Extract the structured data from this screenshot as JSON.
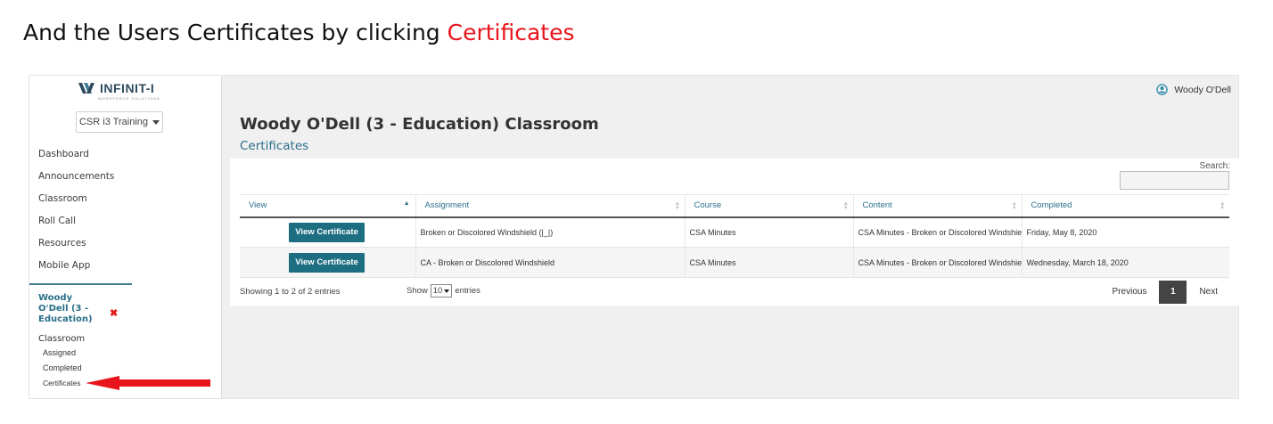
{
  "caption": {
    "prefix": "And the Users Certificates by clicking ",
    "highlight": "Certificates",
    "highlight_color": "#e8141b"
  },
  "brand": {
    "name": "INFINIT-I",
    "tagline": "WORKFORCE SOLUTIONS",
    "logo_icon": "infiniti-logo-icon"
  },
  "tenant_select": {
    "value": "CSR i3 Training"
  },
  "sidebar": {
    "items": [
      {
        "label": "Dashboard"
      },
      {
        "label": "Announcements"
      },
      {
        "label": "Classroom"
      },
      {
        "label": "Roll Call"
      },
      {
        "label": "Resources"
      },
      {
        "label": "Mobile App"
      }
    ],
    "selected_user": {
      "name": "Woody O'Dell (3 - Education)"
    },
    "classroom": {
      "heading": "Classroom",
      "items": [
        {
          "label": "Assigned"
        },
        {
          "label": "Completed"
        },
        {
          "label": "Certificates"
        }
      ]
    },
    "accent_color": "#2a6f8a"
  },
  "header": {
    "user_name": "Woody O'Dell",
    "user_icon": "user-circle-icon"
  },
  "page": {
    "title": "Woody O'Dell (3 - Education) Classroom",
    "subtitle": "Certificates"
  },
  "search": {
    "label": "Search:",
    "value": ""
  },
  "table": {
    "columns": [
      {
        "label": "View"
      },
      {
        "label": "Assignment"
      },
      {
        "label": "Course"
      },
      {
        "label": "Content"
      },
      {
        "label": "Completed"
      }
    ],
    "rows": [
      {
        "button": "View Certificate",
        "assignment": "Broken or Discolored Windshield (|_|)",
        "course": "CSA Minutes",
        "content": "CSA Minutes - Broken or Discolored Windshield",
        "completed": "Friday, May 8, 2020"
      },
      {
        "button": "View Certificate",
        "assignment": "CA - Broken or Discolored Windshield",
        "course": "CSA Minutes",
        "content": "CSA Minutes - Broken or Discolored Windshield",
        "completed": "Wednesday, March 18, 2020"
      }
    ],
    "button_color": "#1e6e82"
  },
  "footer": {
    "info": "Showing 1 to 2 of 2 entries",
    "length_prefix": "Show",
    "length_value": "10",
    "length_suffix": "entries",
    "pagination": {
      "previous": "Previous",
      "current": "1",
      "next": "Next"
    }
  }
}
